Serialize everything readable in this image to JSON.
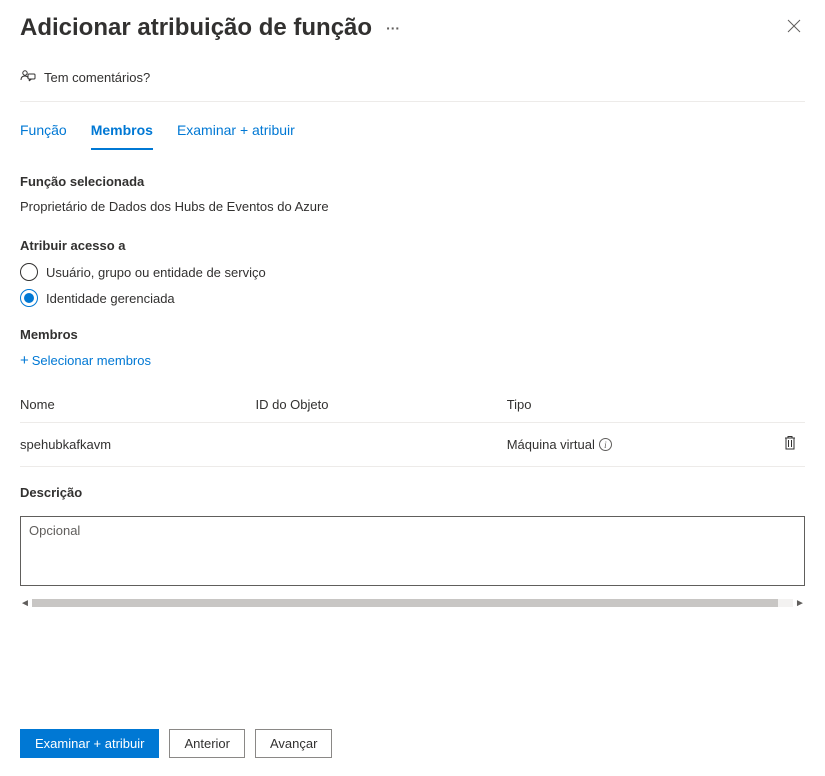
{
  "header": {
    "title": "Adicionar atribuição de função"
  },
  "feedback": {
    "label": "Tem comentários?"
  },
  "tabs": {
    "role": "Função",
    "members": "Membros",
    "review": "Examinar + atribuir"
  },
  "selectedRole": {
    "label": "Função selecionada",
    "value": "Proprietário de Dados dos Hubs de Eventos do Azure"
  },
  "assignAccess": {
    "label": "Atribuir acesso a",
    "option1": "Usuário, grupo ou entidade de serviço",
    "option2": "Identidade gerenciada"
  },
  "members": {
    "label": "Membros",
    "selectLink": "Selecionar membros",
    "columns": {
      "name": "Nome",
      "objectId": "ID do Objeto",
      "type": "Tipo"
    },
    "rows": [
      {
        "name": "spehubkafkavm",
        "objectId": "",
        "type": "Máquina virtual"
      }
    ]
  },
  "description": {
    "label": "Descrição",
    "placeholder": "Opcional"
  },
  "footer": {
    "review": "Examinar + atribuir",
    "previous": "Anterior",
    "next": "Avançar"
  }
}
